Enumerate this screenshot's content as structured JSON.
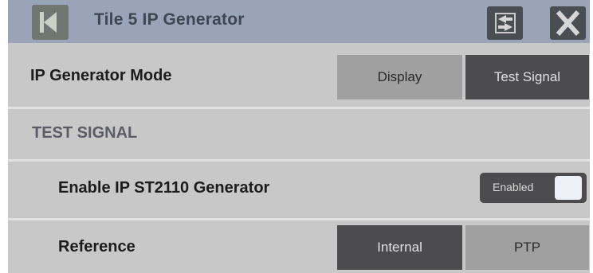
{
  "header": {
    "title": "Tile 5 IP Generator",
    "back_icon": "back-arrow-icon",
    "swap_icon": "swap-arrows-icon",
    "close_icon": "close-x-icon"
  },
  "generator_mode": {
    "label": "IP Generator Mode",
    "options": [
      "Display",
      "Test Signal"
    ],
    "selected": "Test Signal"
  },
  "section": {
    "label": "TEST SIGNAL"
  },
  "enable_generator": {
    "label": "Enable IP ST2110 Generator",
    "state": "Enabled"
  },
  "reference": {
    "label": "Reference",
    "options": [
      "Internal",
      "PTP"
    ],
    "selected": "Internal"
  },
  "colors": {
    "titlebar": "#9aa4b8",
    "panel": "#c8c8c8",
    "selected_segment": "#4c4c4e",
    "unselected_segment": "#a0a0a0"
  }
}
